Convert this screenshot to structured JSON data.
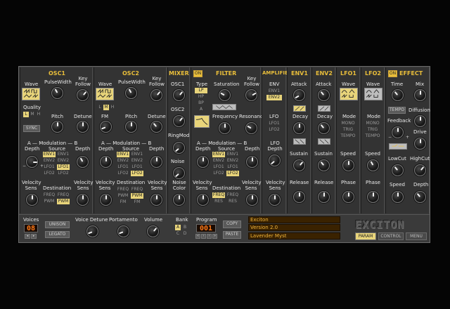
{
  "sections": {
    "osc1": "OSC1",
    "osc2": "OSC2",
    "mixer": "MIXER",
    "filter": "FILTER",
    "amplifier": "AMPLIFIER",
    "env1": "ENV1",
    "env2": "ENV2",
    "lfo1": "LFO1",
    "lfo2": "LFO2",
    "effect": "EFFECT"
  },
  "on_label": "ON",
  "osc1": {
    "wave": "Wave",
    "pulse_width": "PulseWidth",
    "key_follow": "Key Follow",
    "quality": "Quality",
    "quality_opts": [
      "L",
      "M",
      "H"
    ],
    "sync": "SYNC",
    "pitch": "Pitch",
    "detune": "Detune",
    "a_mod_b": "A — Modulation — B",
    "depth": "Depth",
    "source": "Source",
    "sources": [
      "ENV1",
      "ENV1",
      "ENV2",
      "ENV2",
      "LFO1",
      "LFO1",
      "LFO2",
      "LFO2"
    ],
    "destination": "Destination",
    "destinations": [
      "FREQ",
      "FREQ",
      "PWM",
      "PWM"
    ],
    "velocity_sens": "Velocity Sens"
  },
  "osc2": {
    "wave": "Wave",
    "pulse_width": "PulseWidth",
    "key_follow": "Key Follow",
    "quality_opts": [
      "L",
      "M",
      "H"
    ],
    "fm": "FM",
    "pitch": "Pitch",
    "detune": "Detune",
    "a_mod_b": "A — Modulation — B",
    "depth": "Depth",
    "source": "Source",
    "sources": [
      "ENV1",
      "ENV1",
      "ENV2",
      "ENV2",
      "LFO1",
      "LFO1",
      "LFO2",
      "LFO2"
    ],
    "destination": "Destination",
    "destinations": [
      "FREQ",
      "FREQ",
      "PWM",
      "PWM",
      "FM",
      "FM"
    ],
    "velocity_sens": "Velocity Sens"
  },
  "mixer": {
    "osc1": "OSC1",
    "osc2": "OSC2",
    "ringmod": "RingMod",
    "noise": "Noise",
    "noise_color": "Noise Color"
  },
  "filter": {
    "type": "Type",
    "types": [
      "LP",
      "HP",
      "BP",
      "A"
    ],
    "saturation": "Saturation",
    "key_follow": "Key Follow",
    "frequency": "Frequency",
    "resonance": "Resonance",
    "a_mod_b": "A — Modulation — B",
    "depth": "Depth",
    "source": "Source",
    "sources": [
      "ENV1",
      "ENV1",
      "ENV2",
      "ENV2",
      "LFO1",
      "LFO1",
      "LFO2",
      "LFO2"
    ],
    "destination": "Destination",
    "destinations": [
      "FREQ",
      "FREQ",
      "RES",
      "RES"
    ],
    "velocity_sens": "Velocity Sens"
  },
  "amplifier": {
    "env": "ENV",
    "env_opts": [
      "ENV1",
      "ENV2"
    ],
    "lfo": "LFO",
    "lfo_opts": [
      "LFO1",
      "LFO2"
    ],
    "lfo_depth": "LFO Depth",
    "velocity_sens": "Velocity Sens"
  },
  "env1": {
    "attack": "Attack",
    "decay": "Decay",
    "sustain": "Sustain",
    "release": "Release"
  },
  "env2": {
    "attack": "Attack",
    "decay": "Decay",
    "sustain": "Sustain",
    "release": "Release"
  },
  "lfo1": {
    "wave": "Wave",
    "mode": "Mode",
    "modes": [
      "MONO",
      "TRIG",
      "TEMPO"
    ],
    "speed": "Speed",
    "phase": "Phase"
  },
  "lfo2": {
    "wave": "Wave",
    "mode": "Mode",
    "modes": [
      "MONO",
      "TRIG",
      "TEMPO"
    ],
    "speed": "Speed",
    "phase": "Phase"
  },
  "effect": {
    "time": "Time",
    "mix": "Mix",
    "tempo": "TEMPO",
    "diffusion": "Diffusion",
    "feedback": "Feedback",
    "drive": "Drive",
    "lowcut": "LowCut",
    "highcut": "HighCut",
    "speed": "Speed",
    "depth": "Depth"
  },
  "bottom": {
    "voices_label": "Voices",
    "voices_value": "08",
    "unison": "UNISON",
    "legato": "LEGATO",
    "voice_detune": "Voice Detune",
    "portamento": "Portamento",
    "volume": "Volume",
    "bank_label": "Bank",
    "banks": [
      "A",
      "B",
      "C",
      "D"
    ],
    "program_label": "Program",
    "program_value": "001",
    "copy": "COPY",
    "paste": "PASTE",
    "display_lines": [
      "Exciton",
      "Version 2.0",
      "Lavender Myst"
    ],
    "logo": "EXCITON",
    "tabs": [
      "PARAM",
      "CONTROL",
      "MENU"
    ]
  },
  "colors": {
    "accent": "#e9be3a",
    "selected": "#e8d47a",
    "lcd": "#ff7a1a",
    "panel": "#333333"
  }
}
